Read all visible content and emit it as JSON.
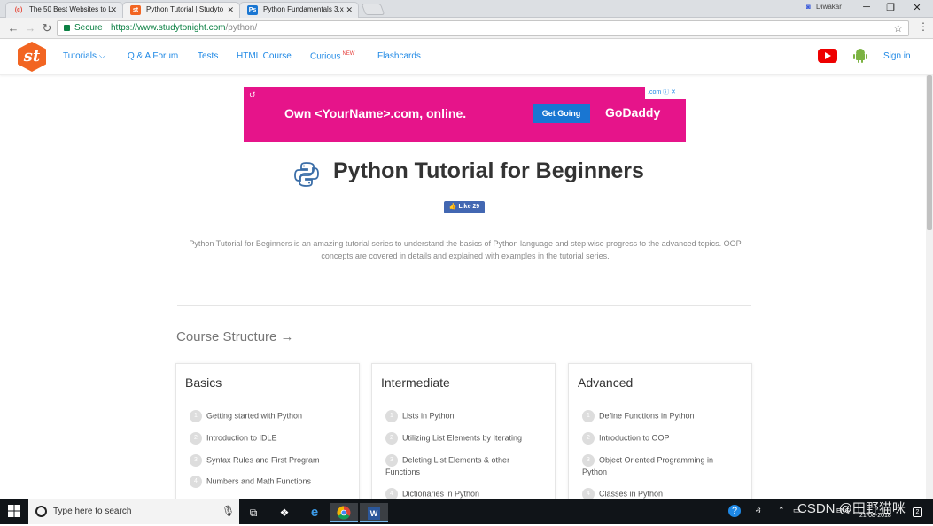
{
  "browser": {
    "tabs": [
      {
        "title": "The 50 Best Websites to L",
        "favicon": "(c)",
        "favicon_color": "#e74c3c"
      },
      {
        "title": "Python Tutorial | Studyto",
        "favicon": "st",
        "favicon_color": "#f26522"
      },
      {
        "title": "Python Fundamentals 3.x",
        "favicon": "Ps",
        "favicon_color": "#1976d2"
      }
    ],
    "user": "Diwakar",
    "secure_label": "Secure",
    "url_host": "https://www.studytonight.com",
    "url_path": "/python/"
  },
  "site": {
    "logo_text": "st",
    "nav": [
      {
        "label": "Tutorials ⌵"
      },
      {
        "label": "Q & A Forum"
      },
      {
        "label": "Tests"
      },
      {
        "label": "HTML Course"
      },
      {
        "label": "Curious",
        "badge": "NEW"
      },
      {
        "label": "Flashcards"
      }
    ],
    "signin": "Sign in"
  },
  "ad": {
    "headline": "Own <YourName>.com, online.",
    "cta": "Get Going",
    "brand": "GoDaddy",
    "badge": ".com"
  },
  "page": {
    "title": "Python Tutorial for Beginners",
    "like": "Like 29",
    "intro": "Python Tutorial for Beginners is an amazing tutorial series to understand the basics of Python language and step wise progress to the advanced topics. OOP concepts are covered in details and explained with examples in the tutorial series.",
    "course_heading": "Course Structure →"
  },
  "cards": [
    {
      "title": "Basics",
      "items": [
        {
          "n": "1",
          "text": "Getting started with Python"
        },
        {
          "n": "2",
          "text": "Introduction to IDLE"
        },
        {
          "n": "3",
          "text": "Syntax Rules and First Program"
        },
        {
          "n": "4",
          "text": "Numbers and Math Functions"
        }
      ]
    },
    {
      "title": "Intermediate",
      "items": [
        {
          "n": "1",
          "text": "Lists in Python"
        },
        {
          "n": "2",
          "text": "Utilizing List Elements by Iterating"
        },
        {
          "n": "3",
          "text": "Deleting List Elements & other Functions"
        },
        {
          "n": "4",
          "text": "Dictionaries in Python"
        }
      ]
    },
    {
      "title": "Advanced",
      "items": [
        {
          "n": "1",
          "text": "Define Functions in Python"
        },
        {
          "n": "2",
          "text": "Introduction to OOP"
        },
        {
          "n": "3",
          "text": "Object Oriented Programming in Python"
        },
        {
          "n": "4",
          "text": "Classes in Python"
        }
      ]
    }
  ],
  "taskbar": {
    "search_placeholder": "Type here to search",
    "lang": "ENG",
    "date": "21-08-2018",
    "notifications": "2"
  },
  "watermark": "CSDN @田野猫咪"
}
